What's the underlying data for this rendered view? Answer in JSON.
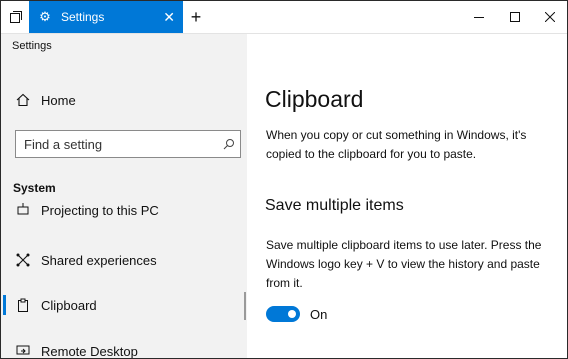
{
  "titlebar": {
    "tab_title": "Settings",
    "icons": {
      "overview": "task-view-icon",
      "tab": "gear-icon",
      "tab_close": "close-icon",
      "new_tab": "plus-icon",
      "minimize": "minimize-icon",
      "maximize": "maximize-icon",
      "close": "close-icon"
    }
  },
  "sidebar": {
    "app_label": "Settings",
    "home_label": "Home",
    "search_placeholder": "Find a setting",
    "section_title": "System",
    "items": [
      {
        "label": "Projecting to this PC",
        "icon": "projector-icon"
      },
      {
        "label": "Shared experiences",
        "icon": "shared-experiences-icon"
      },
      {
        "label": "Clipboard",
        "icon": "clipboard-icon",
        "selected": true
      },
      {
        "label": "Remote Desktop",
        "icon": "remote-desktop-icon"
      }
    ]
  },
  "main": {
    "title": "Clipboard",
    "intro": "When you copy or cut something in Windows, it's copied to the clipboard for you to paste.",
    "section_heading": "Save multiple items",
    "section_desc": "Save multiple clipboard items to use later. Press the Windows logo key + V to view the history and paste from it.",
    "toggle": {
      "state": "On",
      "on": true
    }
  },
  "colors": {
    "accent": "#0078d7",
    "sidebar_bg": "#f2f2f2",
    "text": "#111111"
  }
}
